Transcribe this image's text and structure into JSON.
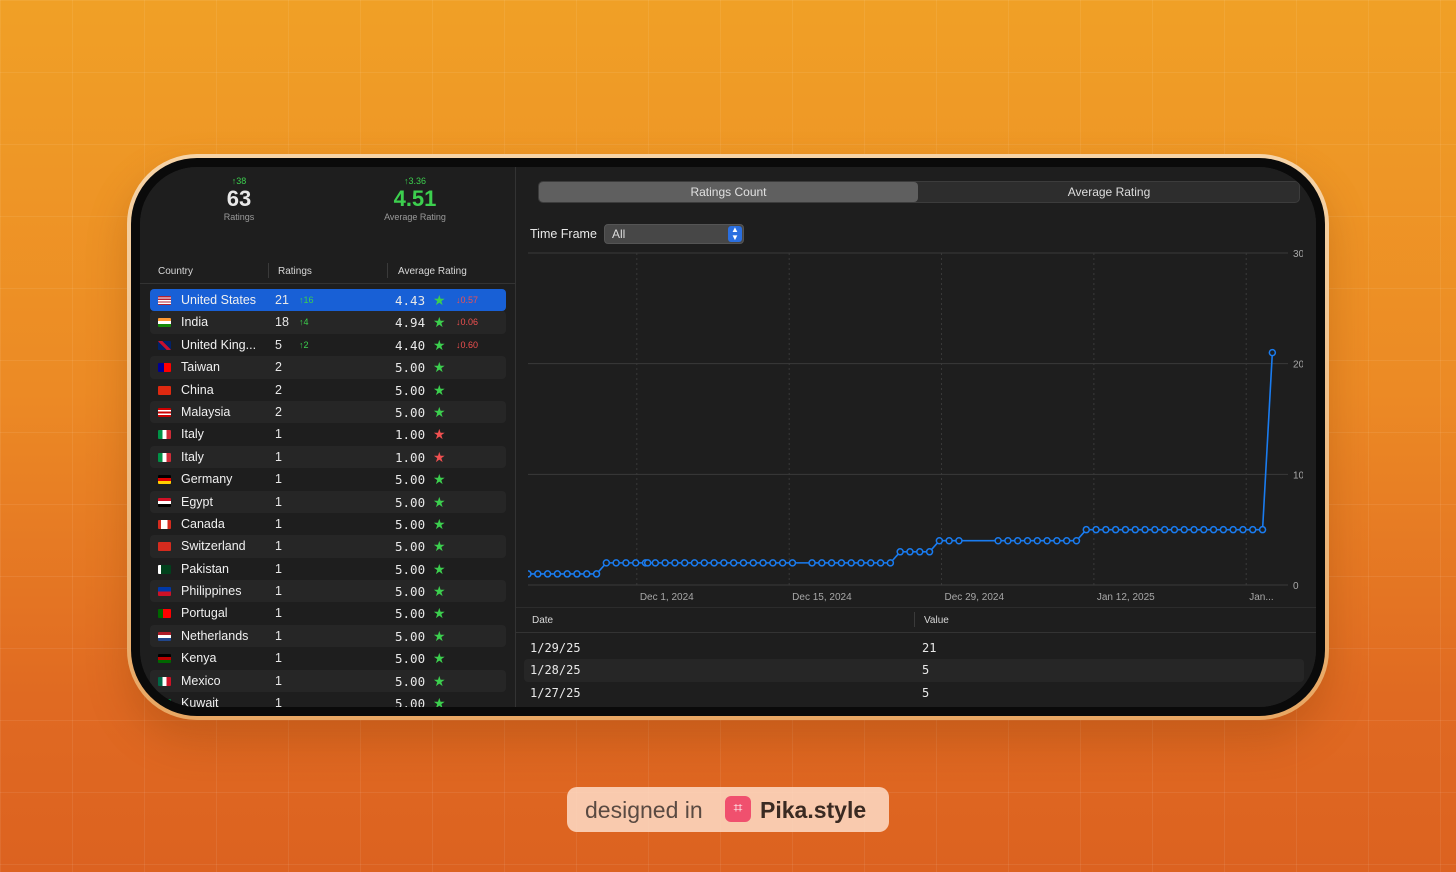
{
  "summary": {
    "ratings": {
      "delta": "↑38",
      "value": "63",
      "label": "Ratings"
    },
    "average": {
      "delta": "↑3.36",
      "value": "4.51",
      "label": "Average Rating"
    }
  },
  "table": {
    "headers": {
      "country": "Country",
      "ratings": "Ratings",
      "average": "Average Rating"
    },
    "rows": [
      {
        "flag": "us",
        "country": "United States",
        "ratings": "21",
        "rdelta": "↑16",
        "avg": "4.43",
        "star": "green",
        "adelta": "↓0.57",
        "selected": true
      },
      {
        "flag": "in",
        "country": "India",
        "ratings": "18",
        "rdelta": "↑4",
        "avg": "4.94",
        "star": "green",
        "adelta": "↓0.06"
      },
      {
        "flag": "gb",
        "country": "United King...",
        "ratings": "5",
        "rdelta": "↑2",
        "avg": "4.40",
        "star": "green",
        "adelta": "↓0.60"
      },
      {
        "flag": "tw",
        "country": "Taiwan",
        "ratings": "2",
        "rdelta": "",
        "avg": "5.00",
        "star": "green",
        "adelta": ""
      },
      {
        "flag": "cn",
        "country": "China",
        "ratings": "2",
        "rdelta": "",
        "avg": "5.00",
        "star": "green",
        "adelta": ""
      },
      {
        "flag": "my",
        "country": "Malaysia",
        "ratings": "2",
        "rdelta": "",
        "avg": "5.00",
        "star": "green",
        "adelta": ""
      },
      {
        "flag": "it",
        "country": "Italy",
        "ratings": "1",
        "rdelta": "",
        "avg": "1.00",
        "star": "red",
        "adelta": ""
      },
      {
        "flag": "it",
        "country": "Italy",
        "ratings": "1",
        "rdelta": "",
        "avg": "1.00",
        "star": "red",
        "adelta": ""
      },
      {
        "flag": "de",
        "country": "Germany",
        "ratings": "1",
        "rdelta": "",
        "avg": "5.00",
        "star": "green",
        "adelta": ""
      },
      {
        "flag": "eg",
        "country": "Egypt",
        "ratings": "1",
        "rdelta": "",
        "avg": "5.00",
        "star": "green",
        "adelta": ""
      },
      {
        "flag": "ca",
        "country": "Canada",
        "ratings": "1",
        "rdelta": "",
        "avg": "5.00",
        "star": "green",
        "adelta": ""
      },
      {
        "flag": "ch",
        "country": "Switzerland",
        "ratings": "1",
        "rdelta": "",
        "avg": "5.00",
        "star": "green",
        "adelta": ""
      },
      {
        "flag": "pk",
        "country": "Pakistan",
        "ratings": "1",
        "rdelta": "",
        "avg": "5.00",
        "star": "green",
        "adelta": ""
      },
      {
        "flag": "ph",
        "country": "Philippines",
        "ratings": "1",
        "rdelta": "",
        "avg": "5.00",
        "star": "green",
        "adelta": ""
      },
      {
        "flag": "pt",
        "country": "Portugal",
        "ratings": "1",
        "rdelta": "",
        "avg": "5.00",
        "star": "green",
        "adelta": ""
      },
      {
        "flag": "nl",
        "country": "Netherlands",
        "ratings": "1",
        "rdelta": "",
        "avg": "5.00",
        "star": "green",
        "adelta": ""
      },
      {
        "flag": "ke",
        "country": "Kenya",
        "ratings": "1",
        "rdelta": "",
        "avg": "5.00",
        "star": "green",
        "adelta": ""
      },
      {
        "flag": "mx",
        "country": "Mexico",
        "ratings": "1",
        "rdelta": "",
        "avg": "5.00",
        "star": "green",
        "adelta": ""
      },
      {
        "flag": "kw",
        "country": "Kuwait",
        "ratings": "1",
        "rdelta": "",
        "avg": "5.00",
        "star": "green",
        "adelta": ""
      }
    ]
  },
  "tabs": [
    {
      "label": "Ratings Count",
      "active": true
    },
    {
      "label": "Average Rating",
      "active": false
    }
  ],
  "timeframe": {
    "label": "Time Frame",
    "value": "All"
  },
  "chart_data": {
    "type": "line",
    "y_ticks": [
      "30",
      "20",
      "10",
      "0"
    ],
    "ylim": [
      0,
      30
    ],
    "x_labels": [
      "Dec 1, 2024",
      "Dec 15, 2024",
      "Dec 29, 2024",
      "Jan 12, 2025",
      "Jan..."
    ],
    "x_label_days": [
      10,
      24,
      38,
      52,
      66
    ],
    "xlim": [
      0,
      68
    ],
    "grid": true,
    "color": "#1a7cf0",
    "series": [
      {
        "x": [
          0,
          0.9,
          1.8,
          2.7,
          3.6,
          4.5,
          5.4,
          6.3,
          7.2,
          8.1,
          9,
          9.9,
          10.8,
          11,
          11.7,
          12.6,
          13.5,
          14.4,
          15.3,
          16.2,
          17.1,
          18,
          18.9,
          19.8,
          20.7,
          21.6,
          22.5,
          23.4,
          24.3,
          26.1,
          27,
          27.9,
          28.8,
          29.7,
          30.6,
          31.5,
          32.4,
          33.3,
          34.2,
          35.1,
          36,
          36.9,
          37.8,
          38.7,
          39.6,
          43.2,
          44.1,
          45,
          45.9,
          46.8,
          47.7,
          48.6,
          49.5,
          50.4,
          51.3,
          52.2,
          53.1,
          54,
          54.9,
          55.8,
          56.7,
          57.6,
          58.5,
          59.4,
          60.3,
          61.2,
          62.1,
          63,
          63.9,
          64.8,
          65.7,
          66.6,
          67.5,
          68.4
        ],
        "values": [
          1,
          1,
          1,
          1,
          1,
          1,
          1,
          1,
          2,
          2,
          2,
          2,
          2,
          2,
          2,
          2,
          2,
          2,
          2,
          2,
          2,
          2,
          2,
          2,
          2,
          2,
          2,
          2,
          2,
          2,
          2,
          2,
          2,
          2,
          2,
          2,
          2,
          2,
          3,
          3,
          3,
          3,
          4,
          4,
          4,
          4,
          4,
          4,
          4,
          4,
          4,
          4,
          4,
          4,
          5,
          5,
          5,
          5,
          5,
          5,
          5,
          5,
          5,
          5,
          5,
          5,
          5,
          5,
          5,
          5,
          5,
          5,
          5,
          21
        ]
      }
    ]
  },
  "data_table": {
    "headers": {
      "date": "Date",
      "value": "Value"
    },
    "rows": [
      {
        "date": "1/29/25",
        "value": "21"
      },
      {
        "date": "1/28/25",
        "value": "5"
      },
      {
        "date": "1/27/25",
        "value": "5"
      }
    ]
  },
  "badge": {
    "prefix": "designed in",
    "brand": "Pika.style",
    "icon": "crop-icon"
  },
  "colors": {
    "accent": "#1a7cf0",
    "positive": "#3ccf4e",
    "negative": "#f05050",
    "selected_row": "#1860d6"
  }
}
